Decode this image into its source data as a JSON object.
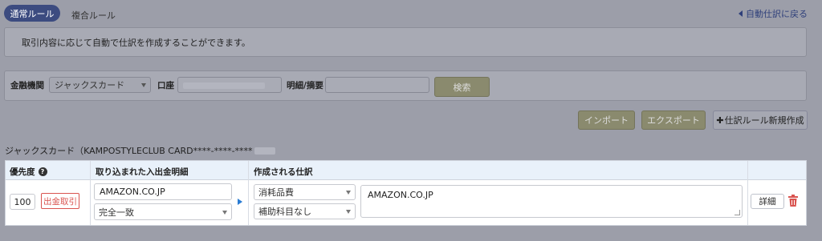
{
  "tabs": {
    "active": "通常ルール",
    "inactive": "複合ルール"
  },
  "back_link": "自動仕訳に戻る",
  "info_message": "取引内容に応じて自動で仕訳を作成することができます。",
  "search": {
    "institution_label": "金融機関",
    "institution_value": "ジャックスカード",
    "account_label": "口座",
    "memo_label": "明細/摘要",
    "memo_value": "",
    "search_button": "検索"
  },
  "actions": {
    "import": "インポート",
    "export": "エクスポート",
    "new_rule": "仕訳ルール新規作成",
    "new_rule_prefix": "✚"
  },
  "card_label": "ジャックスカード（KAMPOSTYLECLUB CARD****-****-****",
  "table": {
    "headers": {
      "priority": "優先度",
      "imported": "取り込まれた入出金明細",
      "created": "作成される仕訳"
    },
    "help_icon": "?",
    "row": {
      "priority": "100",
      "type_badge": "出金取引",
      "description": "AMAZON.CO.JP",
      "match_type": "完全一致",
      "account_item": "消耗品費",
      "sub_account": "補助科目なし",
      "memo": "AMAZON.CO.JP",
      "detail_button": "詳細"
    }
  },
  "colors": {
    "tab_active": "#3c4b80",
    "olive_button": "#8a8a6e",
    "danger": "#d9534f",
    "arrow": "#2b7cd3"
  }
}
